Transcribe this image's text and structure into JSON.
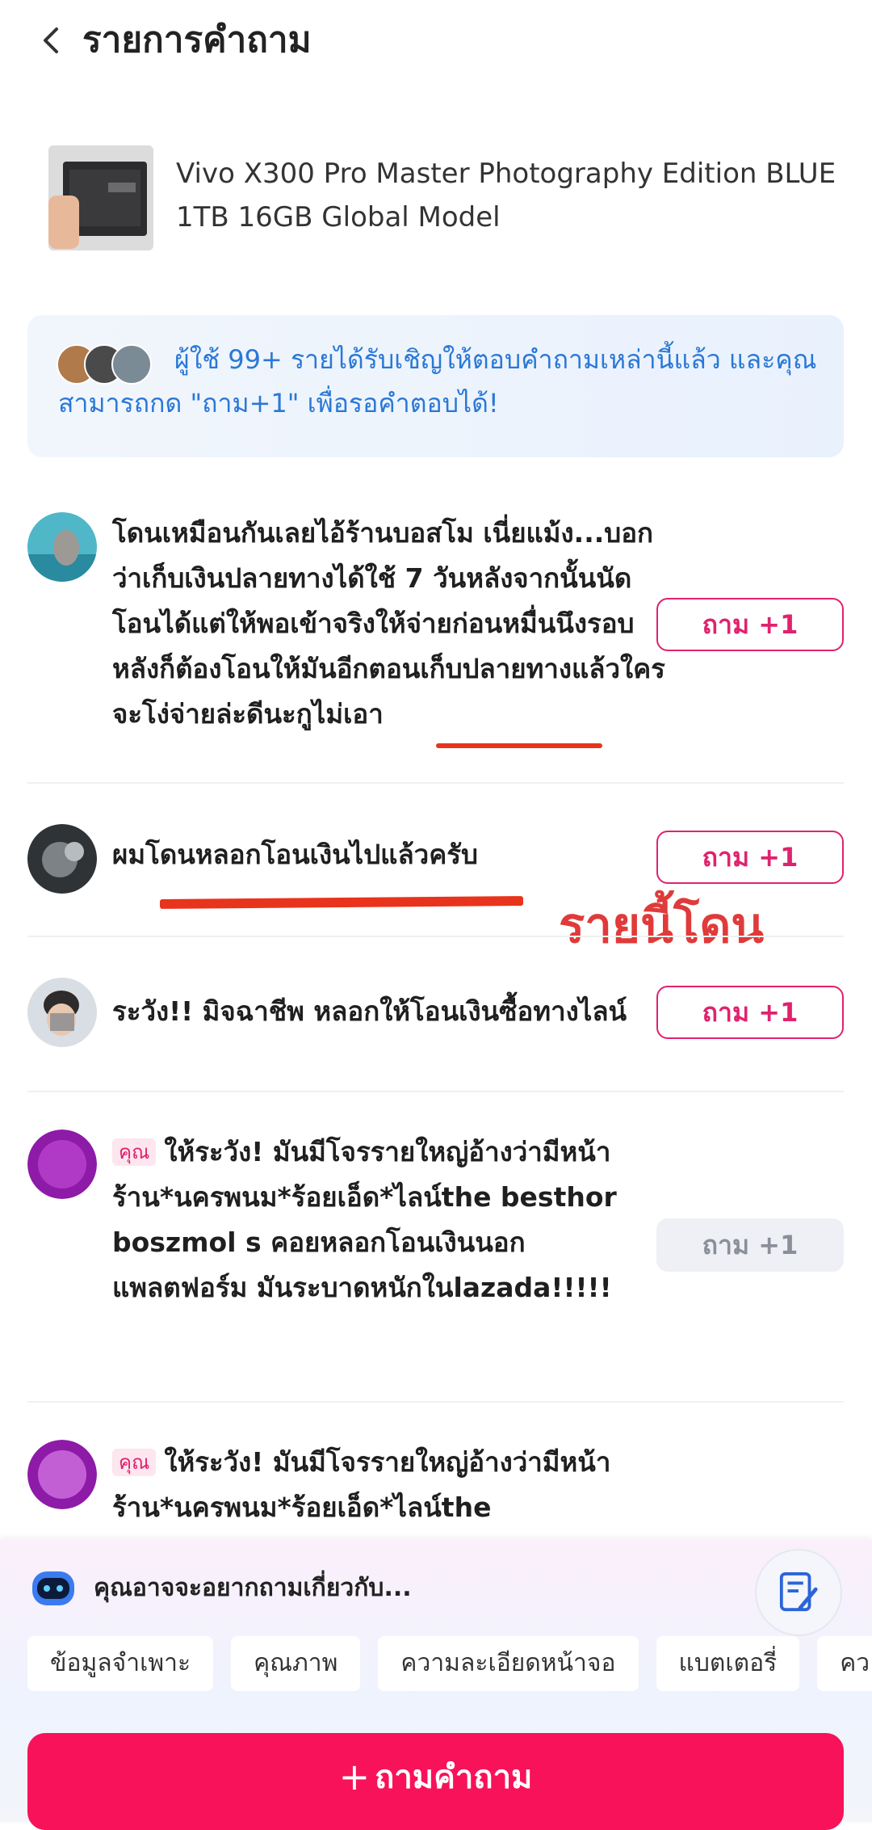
{
  "header": {
    "title": "รายการคำถาม",
    "back_icon": "chevron-left-icon"
  },
  "product": {
    "name": "Vivo X300 Pro Master Photography Edition BLUE 1TB 16GB Global Model"
  },
  "info_banner": {
    "text": "ผู้ใช้ 99+ รายได้รับเชิญให้ตอบคำถามเหล่านี้แล้ว และคุณสามารถกด \"ถาม+1\" เพื่อรอคำตอบได้!",
    "color": "#2a78d6"
  },
  "questions": [
    {
      "text": "โดนเหมือนกันเลยไอ้ร้านบอสโม  เนี่ยแม้ง...บอกว่าเก็บเงินปลายทางได้ใช้ 7 วันหลังจากนั้นนัดโอนได้แต่ให้พอเข้าจริงให้จ่ายก่อนหมื่นนึงรอบหลังก็ต้องโอนให้มันอีกตอนเก็บปลายทางแล้วใครจะโง่จ่ายล่ะดีนะกูไม่เอา",
      "ask_label": "ถาม +1"
    },
    {
      "text": "ผมโดนหลอกโอนเงินไปแล้วครับ",
      "ask_label": "ถาม +1"
    },
    {
      "text": "ระวัง!! มิจฉาชีพ หลอกให้โอนเงินซื้อทางไลน์",
      "ask_label": "ถาม +1"
    },
    {
      "badge": "คุณ",
      "text": "ให้ระวัง! มันมีโจรรายใหญ่อ้างว่ามีหน้าร้าน*นครพนม*ร้อยเอ็ด*ไลน์the besthor   boszmol   s คอยหลอกโอนเงินนอกแพลตฟอร์ม มันระบาดหนักในlazada!!!!!",
      "ask_label": "ถาม +1"
    },
    {
      "badge": "คุณ",
      "text": "ให้ระวัง! มันมีโจรรายใหญ่อ้างว่ามีหน้าร้าน*นครพนม*ร้อยเอ็ด*ไลน์the"
    }
  ],
  "annotation": {
    "text": "รายนี้โดน",
    "color": "#e03a3a"
  },
  "suggestions": {
    "title": "คุณอาจจะอยากถามเกี่ยวกับ...",
    "chips": [
      "ข้อมูลจำเพาะ",
      "คุณภาพ",
      "ความละเอียดหน้าจอ",
      "แบตเตอรี่",
      "คว"
    ]
  },
  "ask_button": {
    "plus": "+",
    "label": "ถามคำถาม",
    "color": "#f8125a"
  },
  "accent_color": "#e0226e"
}
